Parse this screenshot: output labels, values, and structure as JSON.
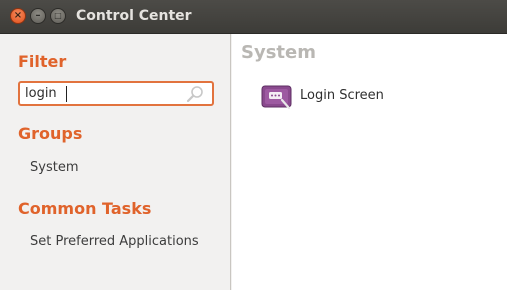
{
  "window": {
    "title": "Control Center",
    "controls": {
      "close_glyph": "×",
      "minimize_glyph": "–",
      "maximize_glyph": "□"
    }
  },
  "sidebar": {
    "filter": {
      "heading": "Filter",
      "search_value": "login",
      "icon": "search-icon"
    },
    "groups": {
      "heading": "Groups",
      "items": [
        {
          "label": "System"
        }
      ]
    },
    "common_tasks": {
      "heading": "Common Tasks",
      "items": [
        {
          "label": "Set Preferred Applications"
        }
      ]
    }
  },
  "main": {
    "heading": "System",
    "launchers": [
      {
        "label": "Login Screen",
        "icon": "login-screen-icon"
      }
    ]
  },
  "colors": {
    "accent": "#e0632b",
    "focus_border": "#e2733e",
    "titlebar": "#3d3c38",
    "icon_purple": "#8a4a8e"
  }
}
